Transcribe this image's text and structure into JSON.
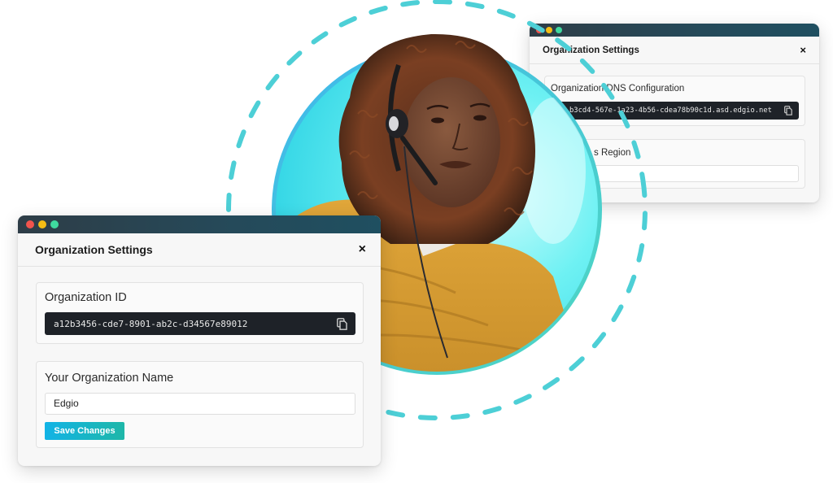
{
  "hero": {
    "image_alt": "Customer support agent wearing a headset",
    "accent_colors": {
      "ring_dash": "#4dcfd6",
      "circle_border_start": "#3fb7ee",
      "circle_border_end": "#4fd8c0",
      "circle_fill": "#5ff0f2"
    }
  },
  "window_left": {
    "title": "Organization Settings",
    "close_label": "×",
    "org_id": {
      "label": "Organization ID",
      "value": "a12b3456-cde7-8901-ab2c-d34567e89012",
      "copy_icon": "copy-icon"
    },
    "org_name": {
      "label": "Your Organization Name",
      "value": "Edgio",
      "save_label": "Save Changes"
    }
  },
  "window_right": {
    "title": "Organization Settings",
    "close_label": "×",
    "dns": {
      "label": "Organization DNS Configuration",
      "value": "a12b3cd4-567e-1a23-4b56-cdea78b90c1d.asd.edgio.net",
      "visible_value": "b3cd4-567e-1a23-4b56-cdea78b90c1d.asd.edgio.net",
      "copy_icon": "copy-icon"
    },
    "region": {
      "label": "s Region",
      "value": ""
    }
  },
  "traffic_lights": {
    "red": "#f2544d",
    "yellow": "#f5bd15",
    "green": "#3fd99f"
  }
}
